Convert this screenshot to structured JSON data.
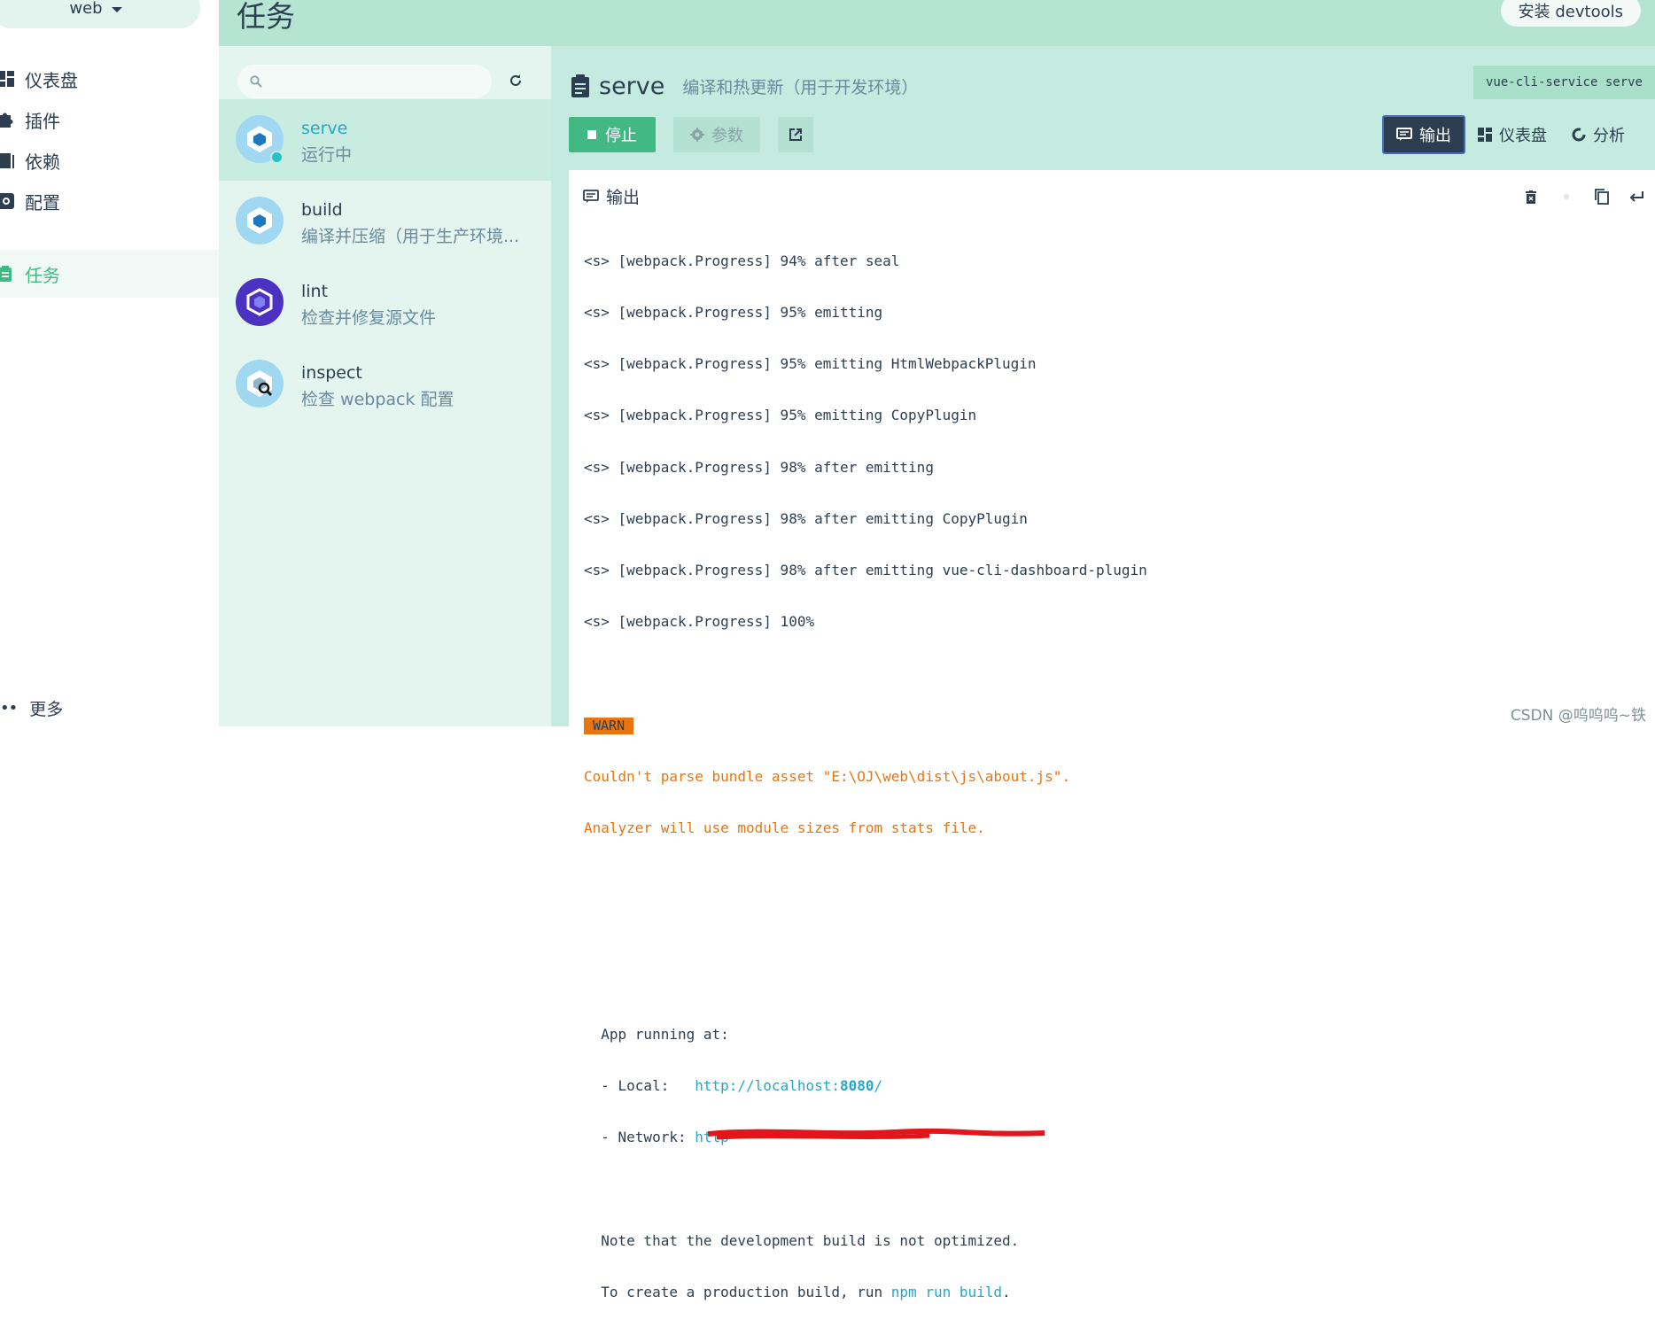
{
  "sidebar": {
    "project": "web",
    "items": [
      {
        "label": "仪表盘",
        "icon": "dashboard-icon"
      },
      {
        "label": "插件",
        "icon": "puzzle-icon"
      },
      {
        "label": "依赖",
        "icon": "book-icon"
      },
      {
        "label": "配置",
        "icon": "gear-icon"
      },
      {
        "label": "任务",
        "icon": "clipboard-icon"
      }
    ],
    "active_item": "任务",
    "more": "更多"
  },
  "header": {
    "title": "任务",
    "install_button": "安装 devtools"
  },
  "tasklist": {
    "search_placeholder": "",
    "tasks": [
      {
        "name": "serve",
        "desc": "运行中"
      },
      {
        "name": "build",
        "desc": "编译并压缩（用于生产环境..."
      },
      {
        "name": "lint",
        "desc": "检查并修复源文件"
      },
      {
        "name": "inspect",
        "desc": "检查 webpack 配置"
      }
    ]
  },
  "task_detail": {
    "name": "serve",
    "description": "编译和热更新（用于开发环境）",
    "command": "vue-cli-service serve",
    "stop_button": "停止",
    "params_button": "参数",
    "tabs": [
      "输出",
      "仪表盘",
      "分析"
    ],
    "active_tab": "输出"
  },
  "output": {
    "title": "输出",
    "lines": [
      "<s> [webpack.Progress] 94% after seal",
      "<s> [webpack.Progress] 95% emitting",
      "<s> [webpack.Progress] 95% emitting HtmlWebpackPlugin",
      "<s> [webpack.Progress] 95% emitting CopyPlugin",
      "<s> [webpack.Progress] 98% after emitting",
      "<s> [webpack.Progress] 98% after emitting CopyPlugin",
      "<s> [webpack.Progress] 98% after emitting vue-cli-dashboard-plugin",
      "<s> [webpack.Progress] 100%"
    ],
    "warn_badge": "WARN",
    "warn_lines": [
      "Couldn't parse bundle asset \"E:\\OJ\\web\\dist\\js\\about.js\".",
      "Analyzer will use module sizes from stats file."
    ],
    "app_running": "  App running at:",
    "local_prefix": "  - Local:   ",
    "local_url_host": "http://localhost:",
    "local_url_port": "8080",
    "local_url_tail": "/",
    "network_prefix": "  - Network: ",
    "network_url": "http",
    "note1": "  Note that the development build is not optimized.",
    "note2_prefix": "  To create a production build, run ",
    "note2_cmd": "npm run build",
    "note2_suffix": "."
  },
  "watermark": "CSDN @呜呜呜~铁"
}
